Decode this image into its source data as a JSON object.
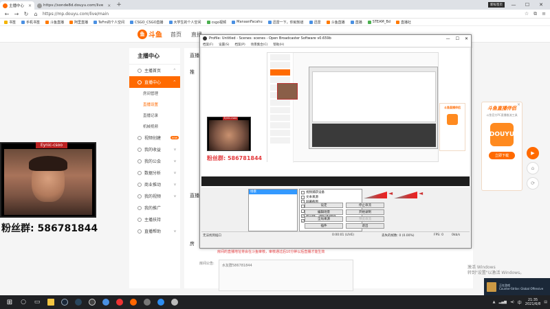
{
  "browser": {
    "tabs": [
      {
        "label": "主播中心",
        "active": true
      },
      {
        "label": "https://sonde8d.douyu.com/live",
        "active": false
      }
    ],
    "new_tab": "+",
    "hint_badge": "新标签页",
    "url": "https://mp.douyu.com/live/main",
    "bookmarks": [
      "书签",
      "手机书签",
      "斗鱼直播",
      "阿里直播",
      "TeFm的个人空间",
      "CSGO_CSGO直播",
      "大学生的个人空间",
      "csgo视频",
      "ManaanFacahu",
      "迅雷一下，你就知道",
      "迅雷",
      "斗鱼直播",
      "直播",
      "STEAM_Bd",
      "直播社"
    ]
  },
  "douyu": {
    "logo_text": "斗鱼",
    "nav_links": [
      "首页",
      "直播"
    ],
    "sidebar": {
      "title": "主播中心",
      "items": [
        {
          "label": "主播首页",
          "type": "item",
          "arrow": "^"
        },
        {
          "label": "直播中心",
          "type": "item",
          "arrow": "^",
          "active": true
        },
        {
          "label": "房间管理",
          "type": "sub"
        },
        {
          "label": "直播设置",
          "type": "sub",
          "active": true
        },
        {
          "label": "直播记录",
          "type": "sub"
        },
        {
          "label": "机械视频",
          "type": "sub"
        },
        {
          "label": "视频创建",
          "type": "item",
          "badge": "new"
        },
        {
          "label": "我的收益",
          "type": "item",
          "arrow": "v"
        },
        {
          "label": "我的公会",
          "type": "item",
          "arrow": "v"
        },
        {
          "label": "数据分析",
          "type": "item",
          "arrow": "v"
        },
        {
          "label": "商业推动",
          "type": "item",
          "arrow": "v"
        },
        {
          "label": "我的视频",
          "type": "item",
          "arrow": "v"
        },
        {
          "label": "我的推广",
          "type": "item"
        },
        {
          "label": "主播扶持",
          "type": "item"
        },
        {
          "label": "直播帮助",
          "type": "item",
          "arrow": "v"
        }
      ]
    },
    "content_labels": [
      "直播",
      "推",
      "直播",
      "房"
    ],
    "warning": "房间的直播地址将会在斗鱼审核，审核通过后10分钟以后直播才能生效",
    "notice_label": "房间公告:",
    "notice_value": "水友群586781844"
  },
  "ad": {
    "title": "斗鱼直播伴侣",
    "subtitle": "斗鱼官方PC直播推流工具",
    "logo_text": "DOUYU",
    "button": "立即下载",
    "close": "×"
  },
  "webcam": {
    "title": "Eynic-csoo",
    "fans_prefix": "粉丝群:",
    "fans_number": "586781844"
  },
  "obs": {
    "title": "Profile: Untitled - Scenes: scenes - Open Broadcaster Software v0.659b",
    "menu": [
      "档案(F)",
      "设置(S)",
      "档案(P)",
      "场景集合(C)",
      "帮助(H)"
    ],
    "preview_fans": "粉丝群:  586781844",
    "preview_cam_title": "Eynic-csoo",
    "scene_selected": "场景",
    "sources": [
      {
        "label": "视频捕获设备",
        "checked": false
      },
      {
        "label": "文本来源",
        "checked": false
      },
      {
        "label": "屏幕截图",
        "checked": false
      },
      {
        "label": "图片源",
        "checked": false
      },
      {
        "label": "文字来源 2",
        "checked": false
      },
      {
        "label": "粉丝群：586781844",
        "checked": true
      },
      {
        "label": "显示器捕获",
        "checked": true
      }
    ],
    "buttons": [
      {
        "label": "设定",
        "enabled": true
      },
      {
        "label": "停止串流",
        "enabled": true
      },
      {
        "label": "编辑场景",
        "enabled": true
      },
      {
        "label": "开始录制",
        "enabled": true
      },
      {
        "label": "全局来源",
        "enabled": true
      },
      {
        "label": "预览串流",
        "enabled": false
      },
      {
        "label": "插件",
        "enabled": true
      },
      {
        "label": "退出",
        "enabled": true
      }
    ],
    "status": {
      "left": "无法找到插口",
      "time": "0:00:01 (LIVE)",
      "dropped": "丢失的帧数: 0 (0.00%)",
      "fps": "FPS: 0",
      "bitrate": "0kb/s"
    }
  },
  "windows": {
    "activate_line1": "激活 Windows",
    "activate_line2": "转到\"设置\"以激活 Windows。",
    "steam_notification": [
      "正在游戏",
      "Counter-Strike: Global Offensive"
    ],
    "lang": "中",
    "time": "21:35",
    "date": "2021/6/8"
  },
  "colors": {
    "douyu_orange": "#ff6a00",
    "warning_red": "#e4393c",
    "obs_selection_blue": "#3399ff",
    "taskbar": "#202124"
  }
}
